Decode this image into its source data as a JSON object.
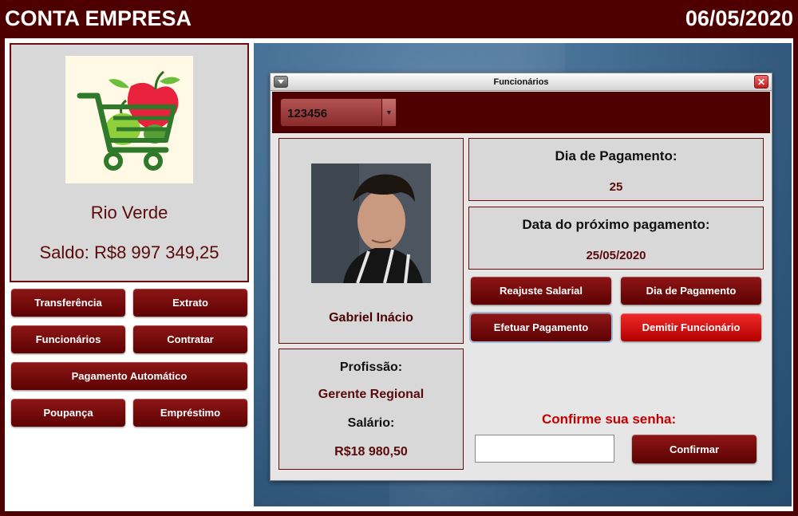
{
  "header": {
    "title": "CONTA EMPRESA",
    "date": "06/05/2020"
  },
  "company": {
    "name": "Rio Verde",
    "balance": "Saldo: R$8 997 349,25"
  },
  "sidebar": {
    "transfer": "Transferência",
    "statement": "Extrato",
    "employees": "Funcionários",
    "hire": "Contratar",
    "auto_payment": "Pagamento Automático",
    "savings": "Poupança",
    "loan": "Empréstimo"
  },
  "window": {
    "title": "Funcionários",
    "close_glyph": "✕",
    "employee_id": "123456",
    "dropdown_glyph": "▼"
  },
  "employee": {
    "name": "Gabriel Inácio",
    "profession_label": "Profissão:",
    "profession": "Gerente Regional",
    "salary_label": "Salário:",
    "salary": "R$18 980,50"
  },
  "payment": {
    "day_label": "Dia de Pagamento:",
    "day": "25",
    "next_label": "Data do próximo pagamento:",
    "next_date": "25/05/2020"
  },
  "actions": {
    "salary_adjust": "Reajuste Salarial",
    "payment_day": "Dia de Pagamento",
    "make_payment": "Efetuar Pagamento",
    "dismiss": "Demitir Funcionário"
  },
  "confirm": {
    "label": "Confirme sua senha:",
    "password_value": "",
    "button": "Confirmar"
  },
  "colors": {
    "frame": "#4e0000",
    "button": "#7a0a0a",
    "danger": "#e01414",
    "panel": "#d8d8d8",
    "desktop": "#3b6389"
  },
  "icons": {
    "logo": "shopping-cart-with-fruits",
    "window_menu": "chevron-down-icon",
    "window_close": "close-icon"
  }
}
